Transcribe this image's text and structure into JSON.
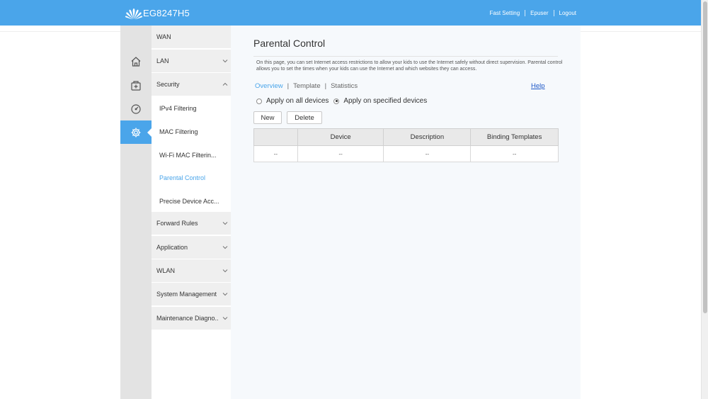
{
  "header": {
    "model": "EG8247H5",
    "links": [
      "Fast Setting",
      "Epuser",
      "Logout"
    ]
  },
  "nav_icons": [
    {
      "name": "home-icon",
      "active": false
    },
    {
      "name": "network-device-icon",
      "active": false
    },
    {
      "name": "diagnostics-icon",
      "active": false
    },
    {
      "name": "gear-icon",
      "active": true
    }
  ],
  "menu": {
    "wan": "WAN",
    "lan": "LAN",
    "security": "Security",
    "security_items": [
      "IPv4 Filtering",
      "MAC Filtering",
      "Wi-Fi MAC Filterin...",
      "Parental Control",
      "Precise Device Acc..."
    ],
    "forward_rules": "Forward Rules",
    "application": "Application",
    "wlan": "WLAN",
    "system_management": "System Management",
    "maintenance": "Maintenance Diagno.."
  },
  "main": {
    "title": "Parental Control",
    "description": "On this page, you can set Internet access restrictions to allow your kids to use the Internet safely without direct supervision. Parental control allows you to set the times when your kids can use the Internet and which websites they can access.",
    "tabs": [
      "Overview",
      "Template",
      "Statistics"
    ],
    "active_tab": "Overview",
    "help": "Help",
    "radio_all": "Apply on all devices",
    "radio_specified": "Apply on specified devices",
    "selected_radio": "specified",
    "btn_new": "New",
    "btn_delete": "Delete",
    "table": {
      "headers": [
        "",
        "Device",
        "Description",
        "Binding Templates"
      ],
      "rows": [
        [
          "--",
          "--",
          "--",
          "--"
        ]
      ]
    }
  },
  "colors": {
    "accent": "#4aa5ea",
    "link": "#1c57c7",
    "menu_bg": "#efefef",
    "icon_column_bg": "#e3e3e3",
    "main_bg": "#f6f9fc"
  }
}
